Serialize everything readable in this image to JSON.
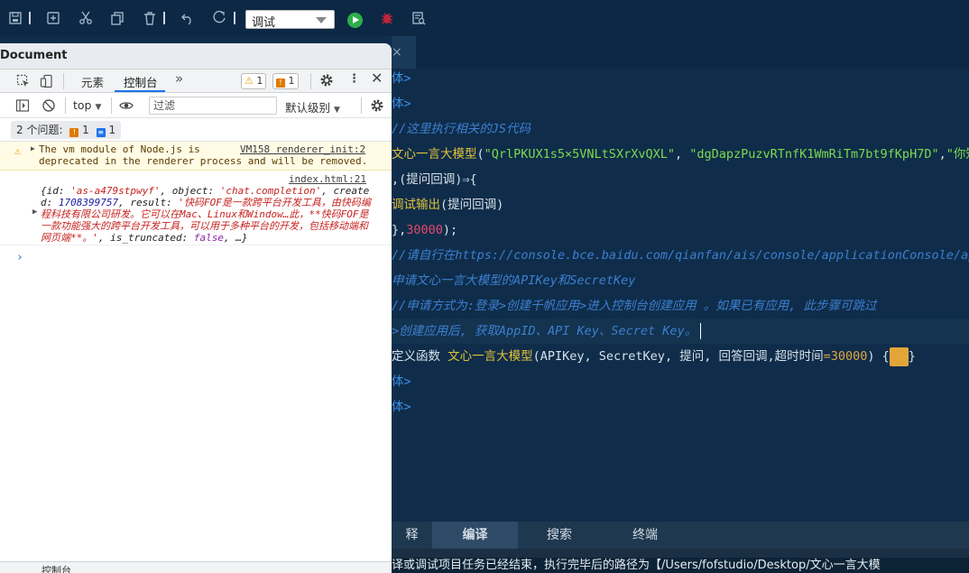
{
  "toolbar": {
    "run_mode": "调试"
  },
  "editor": {
    "lines": [
      {
        "segments": [
          {
            "t": "体>",
            "c": "kw-blue"
          }
        ]
      },
      {
        "segments": [
          {
            "t": "体>",
            "c": "kw-blue"
          }
        ]
      },
      {
        "segments": [
          {
            "t": "//这里执行相关的JS代码",
            "c": "cmt"
          }
        ]
      },
      {
        "segments": [
          {
            "t": "文心一言大模型",
            "c": "fn"
          },
          {
            "t": "(",
            "c": ""
          },
          {
            "t": "\"QrlPKUX1s5×5VNLtSXrXvQXL\"",
            "c": "str"
          },
          {
            "t": ", ",
            "c": ""
          },
          {
            "t": "\"dgDapzPuzvRTnfK1WmRiTm7bt9fKpH7D\"",
            "c": "str"
          },
          {
            "t": ",",
            "c": ""
          },
          {
            "t": "\"你知道",
            "c": "str"
          }
        ]
      },
      {
        "segments": [
          {
            "t": ",(提问回调)⇒{",
            "c": ""
          }
        ]
      },
      {
        "segments": [
          {
            "t": "    ",
            "c": ""
          },
          {
            "t": "调试输出",
            "c": "fn"
          },
          {
            "t": "(提问回调)",
            "c": ""
          }
        ]
      },
      {
        "segments": [
          {
            "t": "},",
            "c": ""
          },
          {
            "t": "30000",
            "c": "num"
          },
          {
            "t": ");",
            "c": ""
          }
        ]
      },
      {
        "segments": [
          {
            "t": "//请自行在https://console.bce.baidu.com/qianfan/ais/console/applicationConsole/appli",
            "c": "cmt"
          }
        ]
      },
      {
        "segments": [
          {
            "t": "申请文心一言大模型的APIKey和SecretKey",
            "c": "cmt"
          }
        ]
      },
      {
        "segments": [
          {
            "t": "//申请方式为:登录>创建千帆应用>进入控制台创建应用 。如果已有应用, 此步骤可跳过",
            "c": "cmt"
          }
        ]
      },
      {
        "segments": [
          {
            "t": ">创建应用后, 获取AppID、API Key、Secret Key。",
            "c": "cmt"
          }
        ],
        "cursor": true
      },
      {
        "segments": [
          {
            "t": "定义函数 ",
            "c": ""
          },
          {
            "t": "文心一言大模型",
            "c": "fn"
          },
          {
            "t": "(APIKey, SecretKey, 提问, 回答回调,超时时间",
            "c": ""
          },
          {
            "t": "=30000",
            "c": "num2"
          },
          {
            "t": ") {",
            "c": ""
          }
        ],
        "fold": true,
        "tail": "}"
      },
      {
        "segments": [
          {
            "t": "体>",
            "c": "kw-blue"
          }
        ]
      },
      {
        "segments": [
          {
            "t": "体>",
            "c": "kw-blue"
          }
        ]
      }
    ]
  },
  "bottom_panel": {
    "tabs": [
      "释",
      "编译",
      "搜索",
      "终端"
    ],
    "active_tab": "编译",
    "message": "译或调试项目任务已经结束，执行完毕后的路径为【/Users/fofstudio/Desktop/文心一言大模"
  },
  "devtools": {
    "title": "Document",
    "tabs": [
      "元素",
      "控制台"
    ],
    "active_tab": "控制台",
    "more_tabs": "»",
    "warn_count": "1",
    "error_count": "1",
    "context": "top",
    "filter_placeholder": "过滤",
    "level": "默认级别",
    "issues_label": "2 个问题:",
    "issues_error": "1",
    "issues_info": "1",
    "warning": {
      "text": "The vm module of Node.js is\ndeprecated in the renderer process and will be removed.",
      "source": "VM158 renderer_init:2"
    },
    "log": {
      "source": "index.html:21",
      "line1_prefix": "{id: ",
      "id": "'as-a479stpwyf'",
      "object_key": ", object: ",
      "object": "'chat.completion'",
      "created_key": ", create\nd: ",
      "created": "1708399757",
      "result_key": ", result: ",
      "result": "'快码FOF是一款跨平台开发工具，由快码编\n程科技有限公司研发。它可以在Mac、Linux和Window…此，**快码FOF是\n一款功能强大的跨平台开发工具，可以用于多种平台的开发，包括移动端和\n网页端**。'",
      "truncated_key": ", is_truncated: ",
      "truncated": "false",
      "tail": ", …}"
    },
    "prompt": "›",
    "drawer_label": "控制台"
  }
}
